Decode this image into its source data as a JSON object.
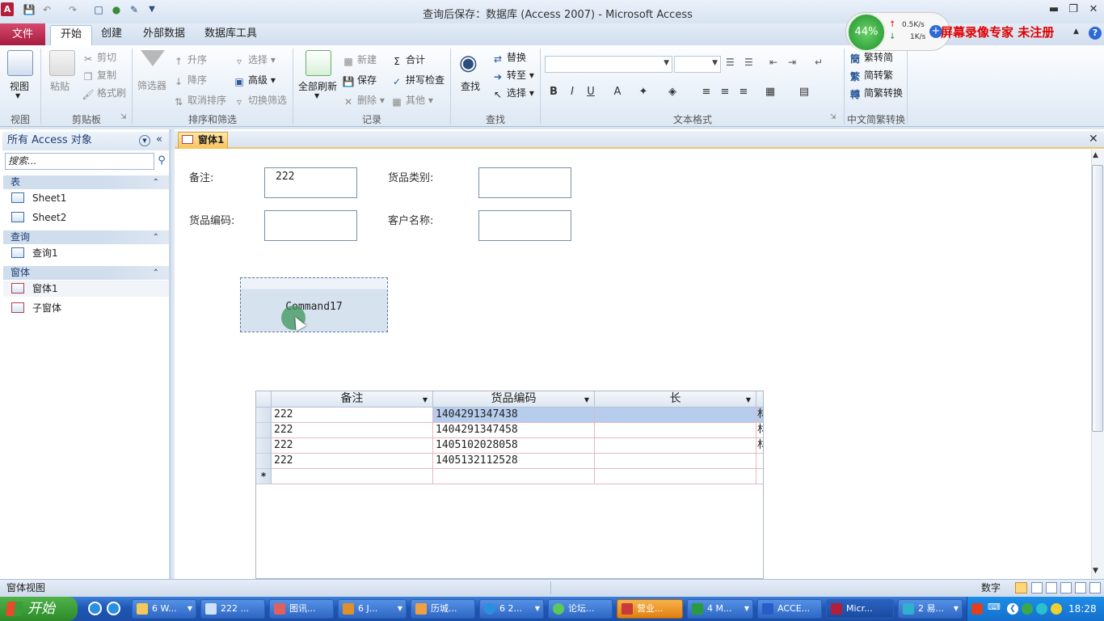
{
  "window": {
    "app_icon": "A",
    "title": "查询后保存：数据库 (Access 2007) - Microsoft Access"
  },
  "ribbon_tabs": {
    "file": "文件",
    "home": "开始",
    "create": "创建",
    "external": "外部数据",
    "dbtools": "数据库工具"
  },
  "ribbon": {
    "view": {
      "label": "视图",
      "group": "视图"
    },
    "clipboard": {
      "paste": "粘贴",
      "cut": "剪切",
      "copy": "复制",
      "format_painter": "格式刷",
      "group": "剪贴板"
    },
    "sort": {
      "filter": "筛选器",
      "asc": "升序",
      "desc": "降序",
      "clear_sort": "取消排序",
      "selection": "选择",
      "advanced": "高级",
      "toggle_filter": "切换筛选",
      "group": "排序和筛选"
    },
    "records": {
      "refresh_all": "全部刷新",
      "new": "新建",
      "save": "保存",
      "delete": "删除",
      "totals": "合计",
      "spelling": "拼写检查",
      "more": "其他",
      "group": "记录"
    },
    "find": {
      "find": "查找",
      "replace": "替换",
      "goto": "转至",
      "select": "选择",
      "group": "查找"
    },
    "text_format": {
      "group": "文本格式"
    },
    "chinese": {
      "to_simplified": "繁转简",
      "to_traditional": "简转繁",
      "convert": "简繁转换",
      "group": "中文简繁转换"
    }
  },
  "overlay": {
    "percent": "44%",
    "up_speed": "0.5K/s",
    "down_speed": "1K/s",
    "watermark": "屏幕录像专家 未注册"
  },
  "nav": {
    "header": "所有 Access 对象",
    "search_placeholder": "搜索...",
    "sections": [
      {
        "title": "表",
        "items": [
          "Sheet1",
          "Sheet2"
        ]
      },
      {
        "title": "查询",
        "items": [
          "查询1"
        ]
      },
      {
        "title": "窗体",
        "items": [
          "窗体1",
          "子窗体"
        ]
      }
    ]
  },
  "document": {
    "tab_label": "窗体1",
    "fields": {
      "remark_label": "备注:",
      "remark_value": "222",
      "category_label": "货品类别:",
      "category_value": "",
      "code_label": "货品编码:",
      "code_value": "",
      "customer_label": "客户名称:",
      "customer_value": ""
    },
    "command_button": "Command17",
    "subform": {
      "columns": [
        "备注",
        "货品编码",
        "长"
      ],
      "rows": [
        [
          "222",
          "1404291347438",
          "",
          "材"
        ],
        [
          "222",
          "1404291347458",
          "",
          "材"
        ],
        [
          "222",
          "1405102028058",
          "",
          "材"
        ],
        [
          "222",
          "1405132112528",
          "",
          ""
        ]
      ],
      "new_row_marker": "*"
    }
  },
  "status": {
    "left": "窗体视图",
    "right": "数字"
  },
  "taskbar": {
    "start": "开始",
    "items": [
      "6 W...",
      "222 ...",
      "图讯...",
      "6 J...",
      "历城...",
      "6 2...",
      "论坛...",
      "营业...",
      "4 M...",
      "ACCE...",
      "Micr...",
      "2 易..."
    ],
    "clock": "18:28"
  }
}
